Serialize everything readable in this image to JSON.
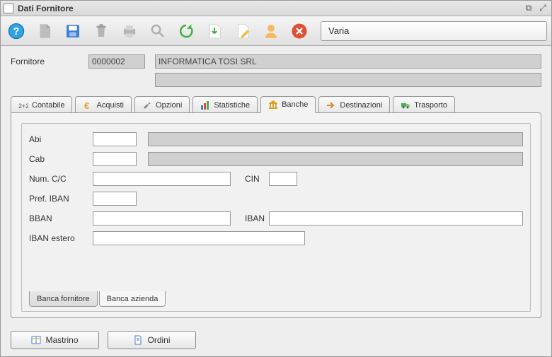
{
  "window": {
    "title": "Dati Fornitore"
  },
  "toolbar": {
    "status": "Varia"
  },
  "supplier": {
    "label": "Fornitore",
    "code": "0000002",
    "name": "INFORMATICA TOSI SRL",
    "line2": ""
  },
  "tabs": [
    {
      "label": "Contabile"
    },
    {
      "label": "Acquisti"
    },
    {
      "label": "Opzioni"
    },
    {
      "label": "Statistiche"
    },
    {
      "label": "Banche"
    },
    {
      "label": "Destinazioni"
    },
    {
      "label": "Trasporto"
    }
  ],
  "bank": {
    "labels": {
      "abi": "Abi",
      "cab": "Cab",
      "numcc": "Num. C/C",
      "cin": "CIN",
      "prefiban": "Pref. IBAN",
      "bban": "BBAN",
      "iban": "IBAN",
      "ibanestero": "IBAN estero"
    },
    "values": {
      "abi": "",
      "abi_desc": "",
      "cab": "",
      "cab_desc": "",
      "numcc": "",
      "cin": "",
      "prefiban": "",
      "bban": "",
      "iban": "",
      "ibanestero": ""
    }
  },
  "subtabs": [
    {
      "label": "Banca fornitore"
    },
    {
      "label": "Banca azienda"
    }
  ],
  "footer": {
    "mastrino": "Mastrino",
    "ordini": "Ordini"
  }
}
